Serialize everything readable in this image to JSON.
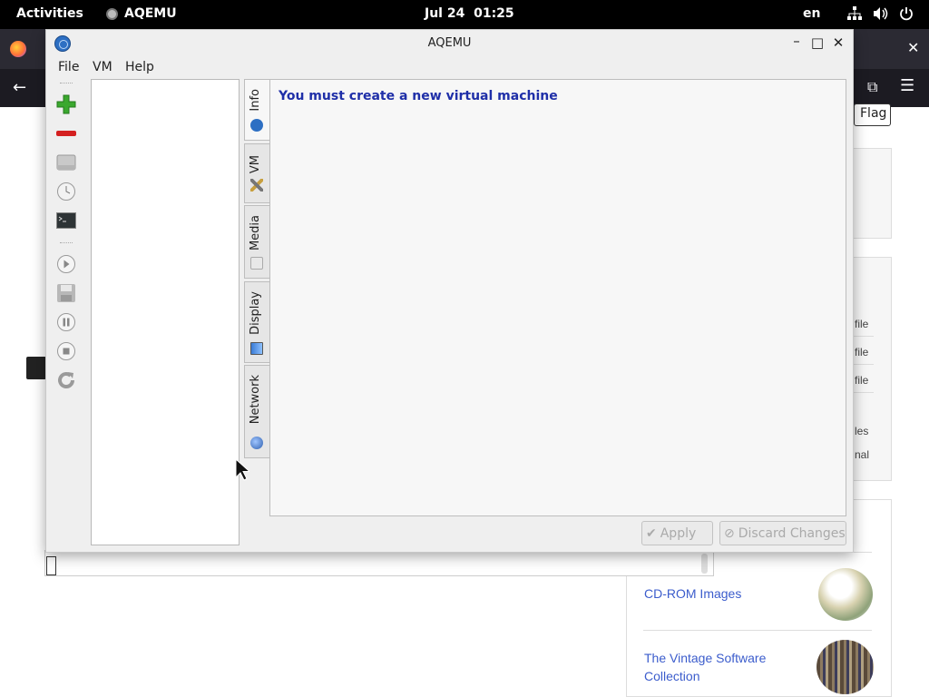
{
  "topbar": {
    "activities": "Activities",
    "app_name": "AQEMU",
    "date": "Jul 24",
    "time": "01:25",
    "language": "en"
  },
  "background": {
    "flag_button": "Flag",
    "side_items": [
      "file",
      "file",
      "file",
      "les",
      "nal"
    ],
    "links": [
      "CD-ROM Images",
      "The Vintage Software Collection"
    ]
  },
  "window": {
    "title": "AQEMU",
    "controls": [
      "minimize",
      "maximize",
      "close"
    ],
    "menu": {
      "file": "File",
      "vm": "VM",
      "help": "Help"
    },
    "toolbar_icons": [
      "add-vm-icon",
      "remove-vm-icon",
      "hard-drive-icon",
      "clock-icon",
      "terminal-icon",
      "play-icon",
      "save-icon",
      "pause-icon",
      "stop-icon",
      "reload-icon"
    ],
    "tabs": [
      {
        "label": "Info",
        "icon": "info-icon"
      },
      {
        "label": "VM",
        "icon": "tools-icon"
      },
      {
        "label": "Media",
        "icon": "media-icon"
      },
      {
        "label": "Display",
        "icon": "display-icon"
      },
      {
        "label": "Network",
        "icon": "network-icon"
      }
    ],
    "info_message": "You must create a new virtual machine",
    "apply_label": "Apply",
    "discard_label": "Discard Changes"
  },
  "colors": {
    "info_text": "#1f2fa8",
    "link": "#3b5ccc",
    "add_icon": "#3aa82e",
    "remove_icon": "#d42020"
  }
}
